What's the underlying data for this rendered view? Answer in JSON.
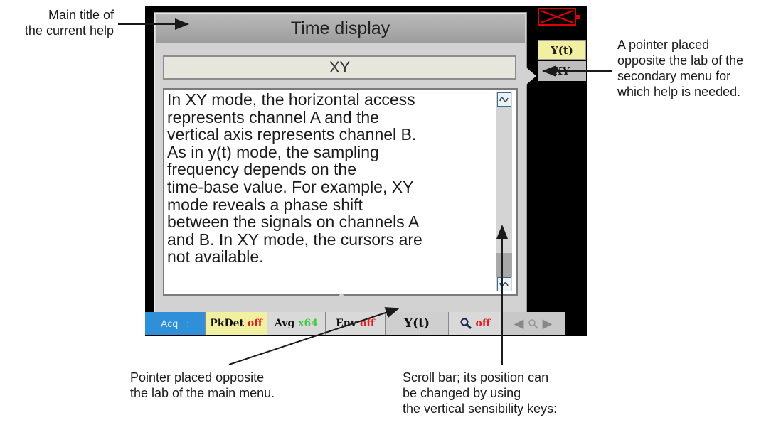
{
  "annotations": {
    "main_title": [
      "Main title of",
      "the current help"
    ],
    "pointer_secondary": [
      "A pointer placed",
      "opposite the lab of the",
      "secondary menu for",
      "which help is needed."
    ],
    "pointer_main": [
      "Pointer placed opposite",
      "the lab of the main menu."
    ],
    "scroll_bar": [
      "Scroll bar; its position can",
      "be changed by using",
      "the vertical sensibility keys:"
    ]
  },
  "help_panel": {
    "title": "Time display",
    "subtitle": "XY",
    "text": "In XY mode, the horizontal access\nrepresents channel A and the\nvertical axis represents channel B.\nAs in y(t) mode, the sampling\nfrequency depends on the\ntime-base value. For example, XY\nmode reveals a phase shift\nbetween the signals on channels A\nand B. In XY mode, the cursors are\nnot available."
  },
  "side_menu": {
    "items": [
      "Y(t)",
      "XY"
    ]
  },
  "bottom_menu": {
    "acq": "Acq",
    "acq_sep": ":",
    "pkdet": "PkDet",
    "pkdet_state": "off",
    "avg": "Avg",
    "avg_value": "x64",
    "env": "Env",
    "env_state": "off",
    "yt": "Y(t)",
    "zoom_state": "off"
  },
  "icons": {
    "scroll_up": "wave-icon",
    "scroll_down": "wave-icon",
    "close": "close-icon",
    "zoom": "magnifier-icon",
    "nav_left": "triangle-left-icon",
    "nav_right": "triangle-right-icon"
  },
  "colors": {
    "acq_tab": "#2f8fd8",
    "pkdet_tab": "#f1f0a0",
    "state_off": "#e02020",
    "avg_value": "#46c746",
    "close_outline": "#e00000"
  }
}
